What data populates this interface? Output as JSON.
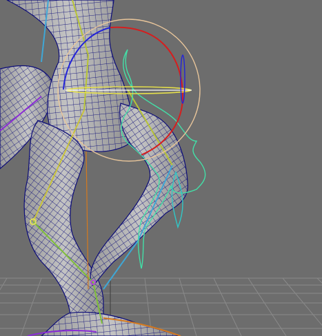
{
  "viewport": {
    "background": "#6d6d6d",
    "mesh_fill": "#b3b3b3",
    "mesh_wire": "#0d0d78",
    "grid_line": "#8a8a8a",
    "grid_axis": "#3a3a3a"
  },
  "rig_controls": {
    "rotate_manipulator": {
      "icon": "rotate-manipulator-icon",
      "outer_ring_color": "#e8c59a",
      "x_axis_color": "#d61e1e",
      "y_axis_color": "#e6e04a",
      "z_axis_color": "#2323d8",
      "view_ring_color": "#ffffff"
    },
    "foot_ik_control": {
      "color": "#43e0a8"
    },
    "knee_pole_control": {
      "color": "#30c7c7"
    },
    "joint_colors": [
      "#b7c436",
      "#7fbf3a",
      "#3fa7d6",
      "#8a2bd6",
      "#d67a1e"
    ]
  }
}
